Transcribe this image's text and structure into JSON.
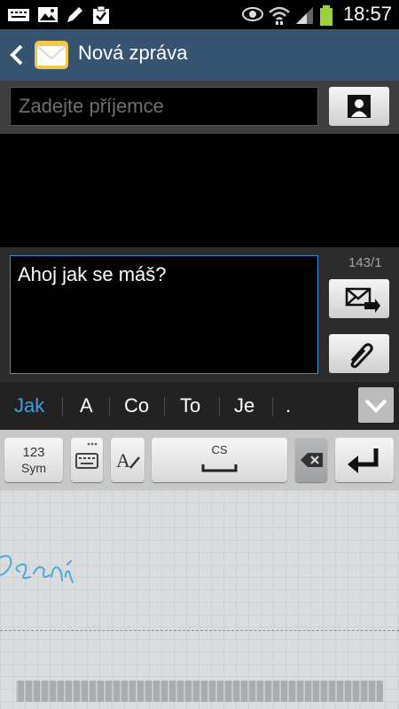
{
  "status_bar": {
    "time": "18:57",
    "icons": [
      "keyboard-icon",
      "image-icon",
      "pen-icon",
      "clipboard-check-icon",
      "eye-icon",
      "wifi-icon",
      "signal-icon",
      "battery-icon"
    ]
  },
  "action_bar": {
    "title": "Nová zpráva"
  },
  "recipient": {
    "placeholder": "Zadejte příjemce"
  },
  "compose": {
    "message": "Ahoj jak se máš?",
    "char_counter": "143/1"
  },
  "predictions": [
    "Jak",
    "A",
    "Co",
    "To",
    "Je",
    "."
  ],
  "keyboard": {
    "sym_line1": "123",
    "sym_line2": "Sym",
    "language": "CS"
  },
  "handwriting": {
    "ink": "Psaní"
  },
  "colors": {
    "accent": "#3b8ec9",
    "action_bar": "#36536f",
    "prediction_highlight": "#3fa0e0"
  }
}
